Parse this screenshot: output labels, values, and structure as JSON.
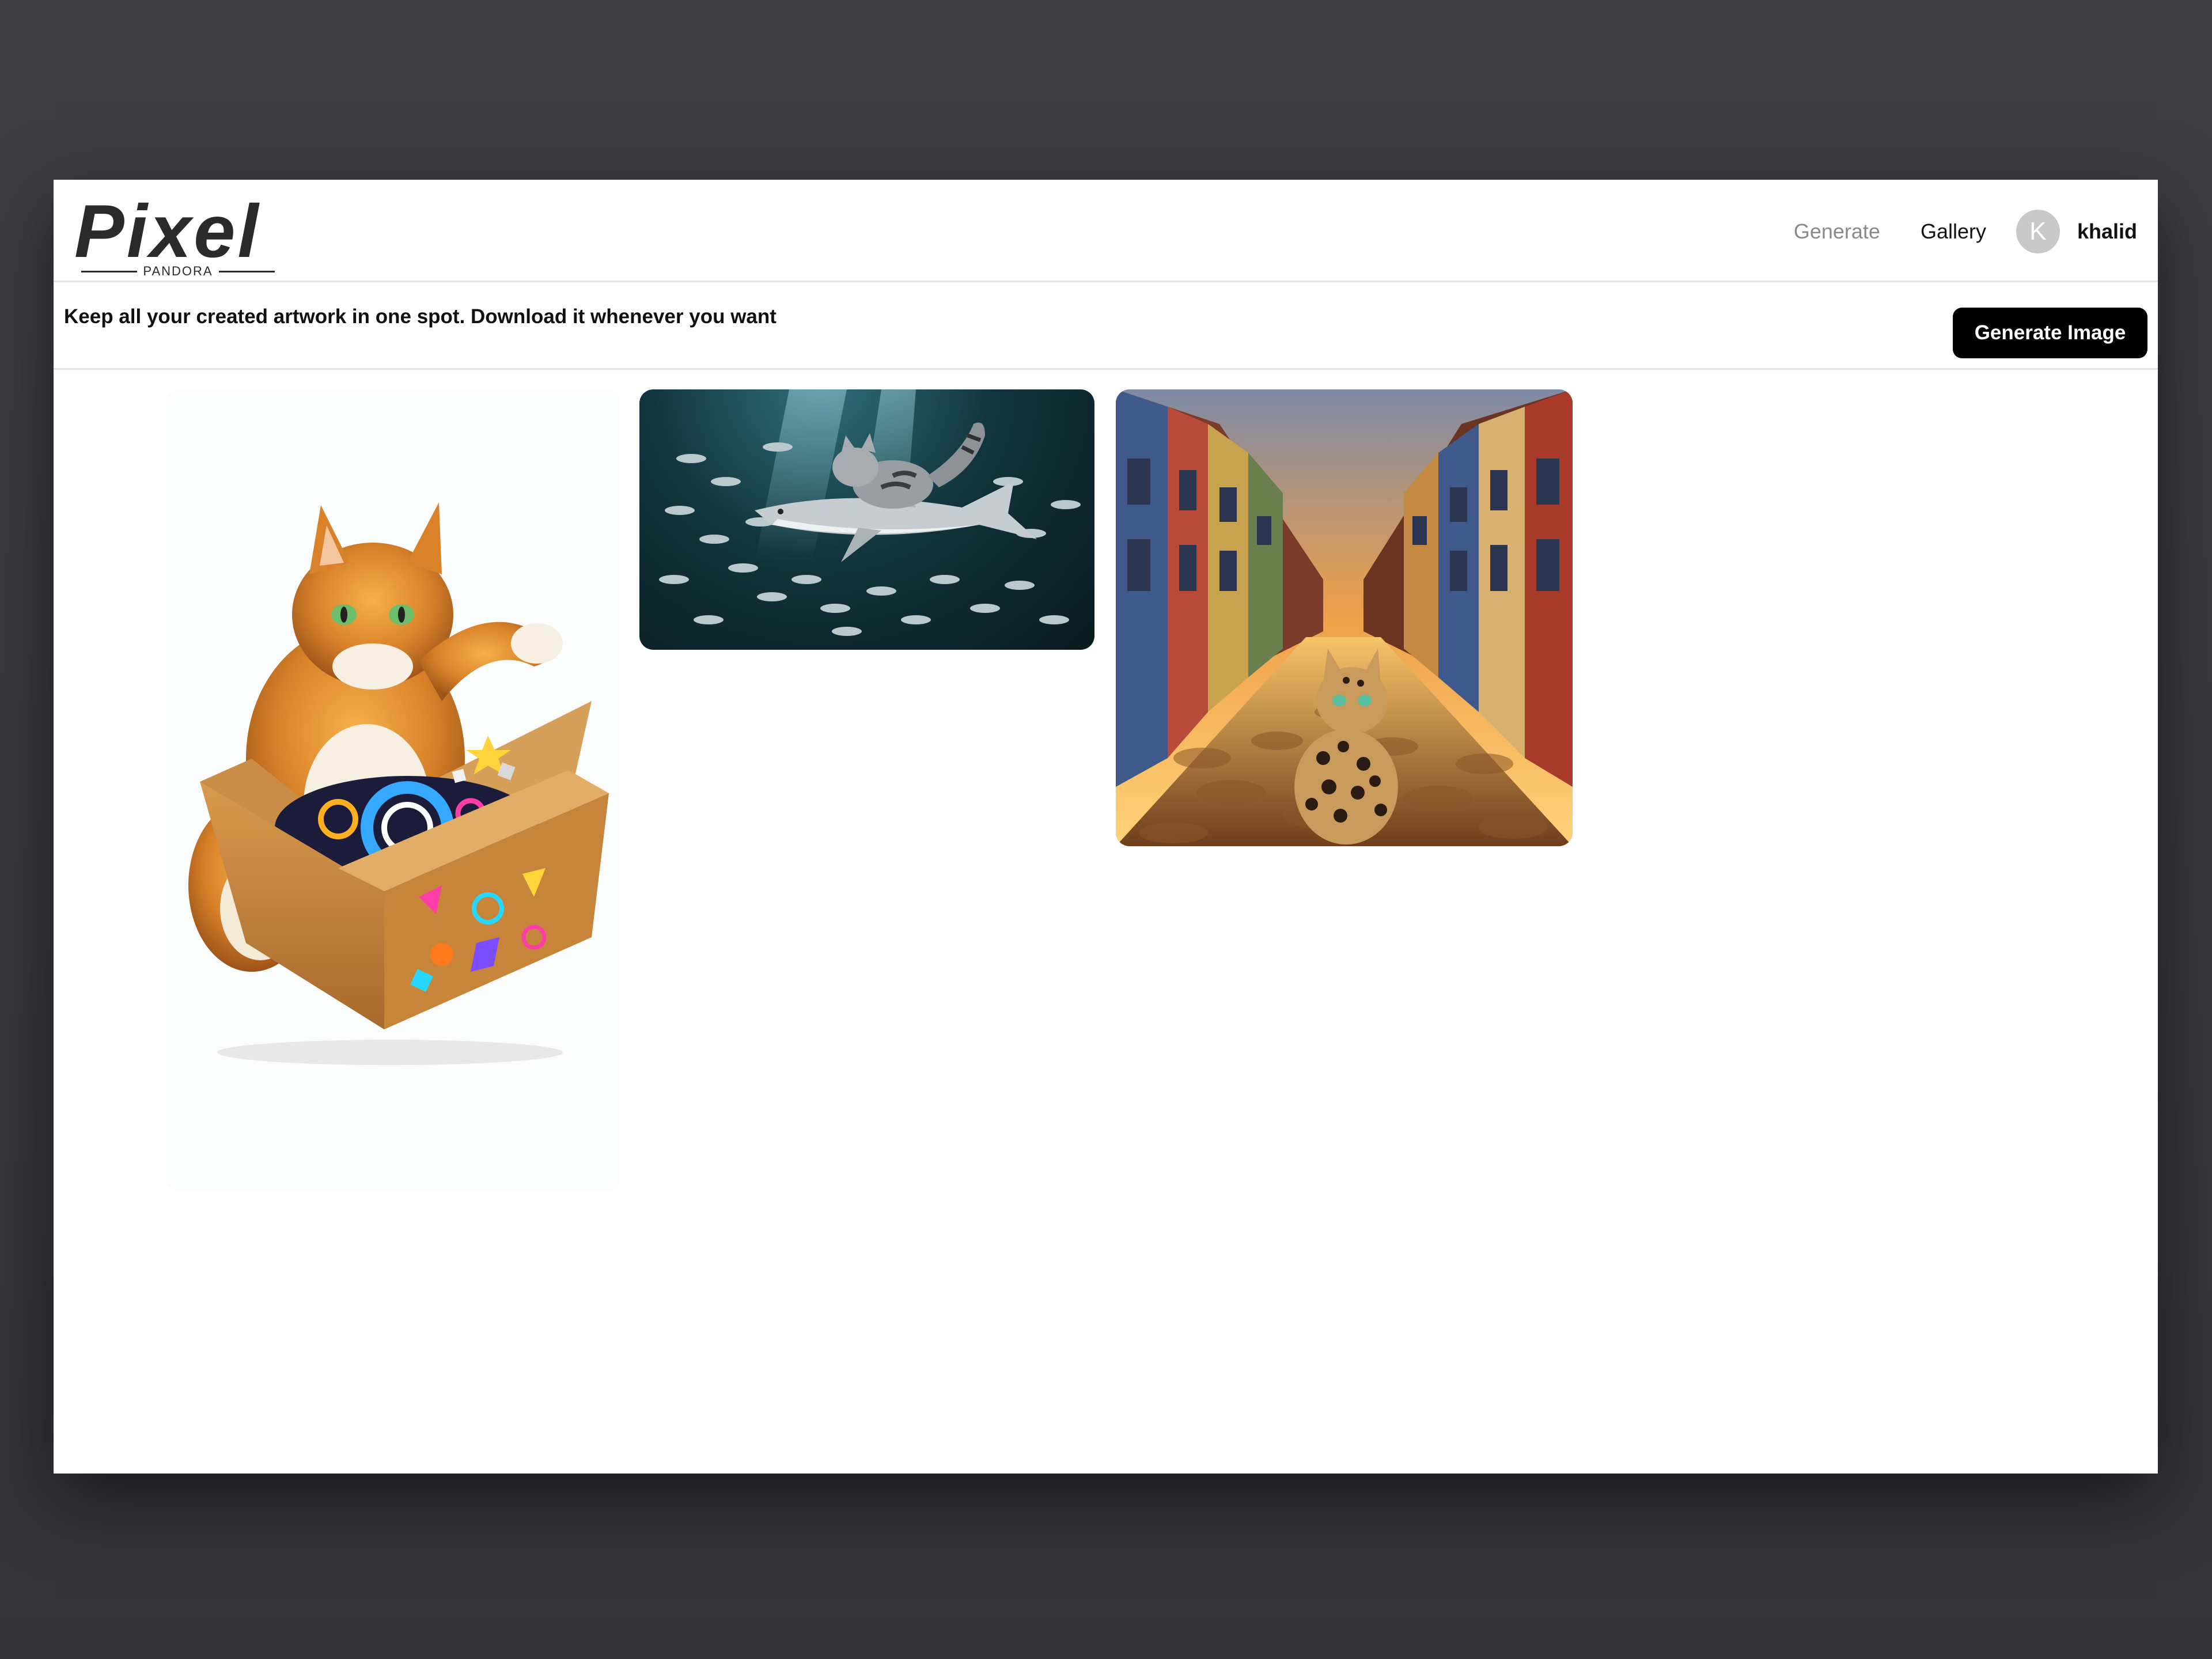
{
  "app": {
    "logo_text": "Pixel",
    "logo_subtext": "PANDORA"
  },
  "header": {
    "nav": {
      "generate_label": "Generate",
      "gallery_label": "Gallery"
    },
    "user": {
      "avatar_initial": "K",
      "username": "khalid"
    }
  },
  "subbar": {
    "tagline": "Keep all your created artwork in one spot. Download it whenever you want",
    "generate_button_label": "Generate Image"
  },
  "gallery": {
    "items": [
      {
        "subject": "orange cat with glowing box"
      },
      {
        "subject": "cat riding shark underwater"
      },
      {
        "subject": "spotted cat on cobblestone street"
      }
    ]
  },
  "colors": {
    "primary_button": "#000000",
    "nav_inactive": "#8a8a8a",
    "avatar_bg": "#c8c8c8"
  }
}
